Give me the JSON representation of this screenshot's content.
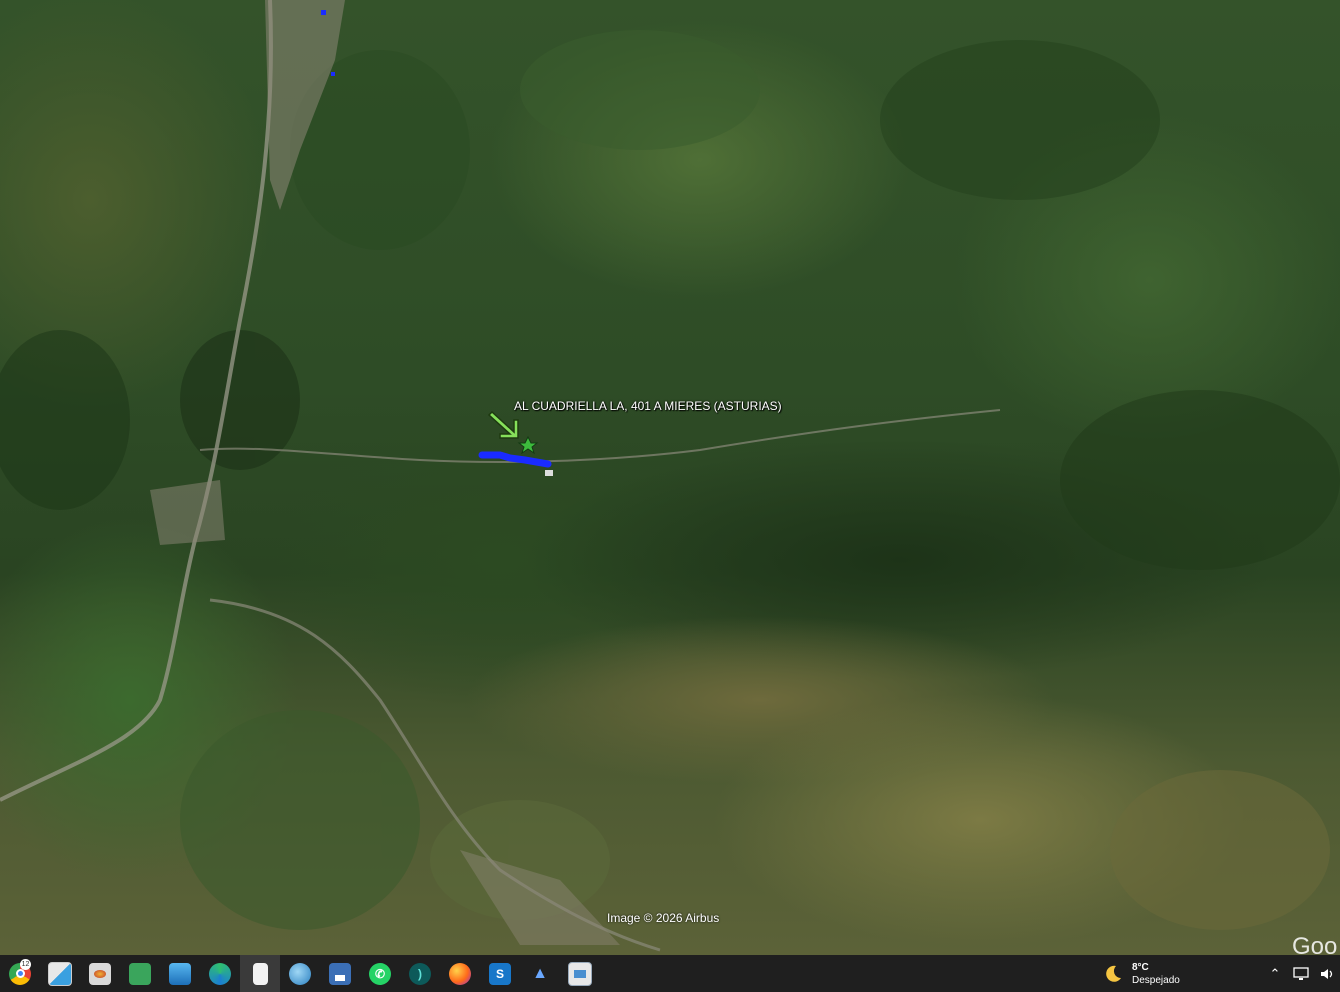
{
  "map": {
    "placemark_label": "AL CUADRIELLA LA, 401 A MIERES (ASTURIAS)",
    "copyright": "Image © 2026 Airbus",
    "logo_text": "Goo"
  },
  "taskbar": {
    "apps": [
      {
        "name": "chrome-icon",
        "badge": "12"
      },
      {
        "name": "maps-app-icon"
      },
      {
        "name": "file-explorer-icon"
      },
      {
        "name": "lock-folder-icon"
      },
      {
        "name": "photos-icon"
      },
      {
        "name": "edge-icon"
      },
      {
        "name": "blank-document-icon",
        "active": true
      },
      {
        "name": "globe-icon"
      },
      {
        "name": "floppy-save-icon"
      },
      {
        "name": "whatsapp-icon"
      },
      {
        "name": "wave-app-icon"
      },
      {
        "name": "firefox-icon"
      },
      {
        "name": "s-app-icon"
      },
      {
        "name": "a-app-icon"
      },
      {
        "name": "window-app-icon"
      }
    ]
  },
  "weather": {
    "temperature": "8°C",
    "condition": "Despejado"
  },
  "colors": {
    "taskbar_bg": "#1f1f1f",
    "route": "#1a2bff",
    "arrow": "#86e05a",
    "star": "#3dbb3d"
  }
}
